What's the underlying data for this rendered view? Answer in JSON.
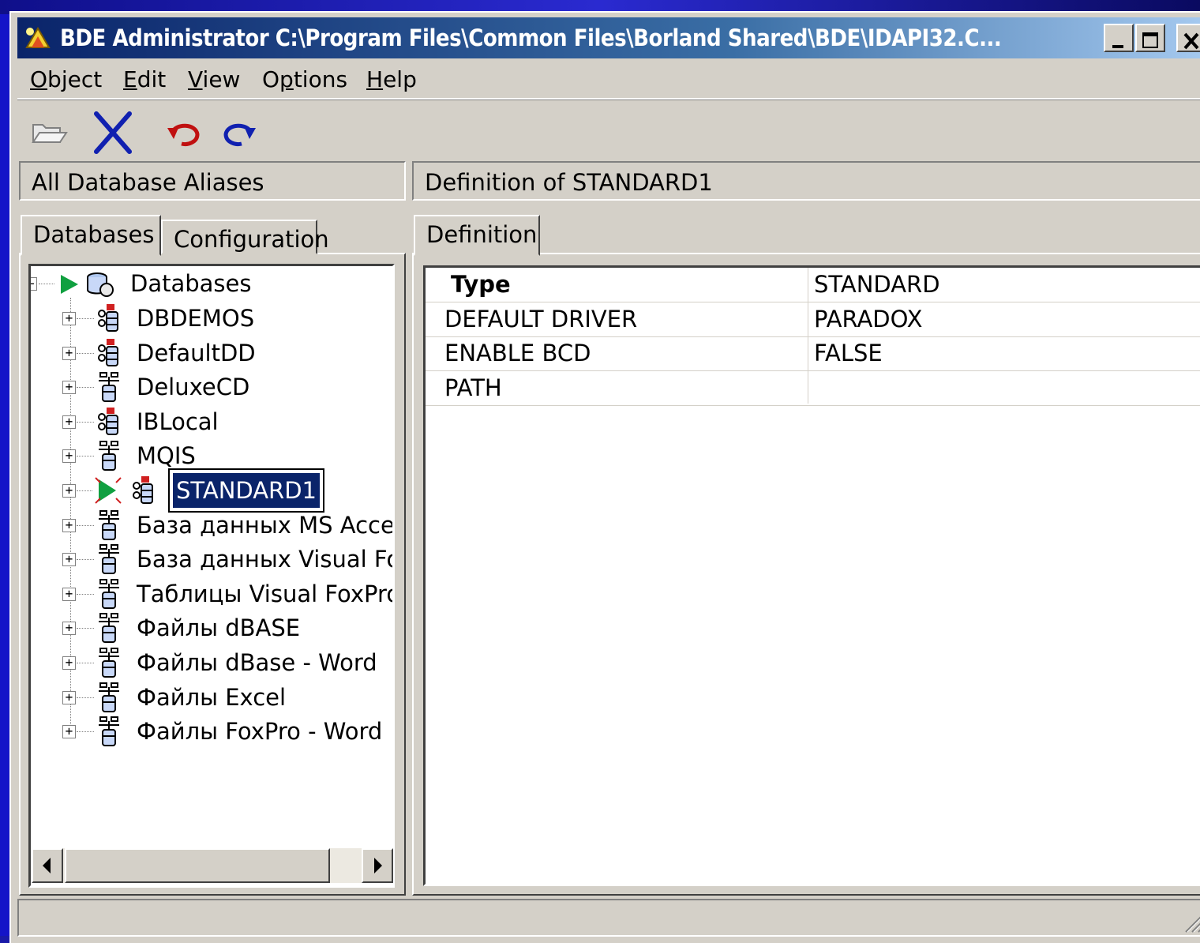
{
  "window": {
    "title": "BDE Administrator  C:\\Program Files\\Common Files\\Borland Shared\\BDE\\IDAPI32.C...",
    "controls": {
      "minimize": "minimize",
      "maximize": "maximize",
      "close": "close"
    }
  },
  "menu": [
    {
      "pre": "",
      "u": "O",
      "post": "bject"
    },
    {
      "pre": "",
      "u": "E",
      "post": "dit"
    },
    {
      "pre": "",
      "u": "V",
      "post": "iew"
    },
    {
      "pre": "O",
      "u": "p",
      "post": "tions"
    },
    {
      "pre": "",
      "u": "H",
      "post": "elp"
    }
  ],
  "toolbar": {
    "open_icon": "open-folder-icon",
    "delete_icon": "delete-x-icon",
    "undo_icon": "undo-arrow-icon",
    "redo_icon": "redo-arrow-icon"
  },
  "left_panel": {
    "header": "All Database Aliases",
    "tabs": [
      "Databases",
      "Configuration"
    ],
    "tree": {
      "root": "Databases",
      "items": [
        {
          "label": "DBDEMOS",
          "icon": "database-alias-icon"
        },
        {
          "label": "DefaultDD",
          "icon": "database-alias-icon"
        },
        {
          "label": "DeluxeCD",
          "icon": "odbc-alias-icon"
        },
        {
          "label": "IBLocal",
          "icon": "database-alias-icon"
        },
        {
          "label": "MQIS",
          "icon": "odbc-alias-icon"
        },
        {
          "label": "STANDARD1",
          "icon": "database-alias-icon",
          "selected": true
        },
        {
          "label": "База данных MS Access",
          "icon": "odbc-alias-icon"
        },
        {
          "label": "База данных Visual FoxPro",
          "icon": "odbc-alias-icon"
        },
        {
          "label": "Таблицы Visual FoxPro",
          "icon": "odbc-alias-icon"
        },
        {
          "label": "Файлы dBASE",
          "icon": "odbc-alias-icon"
        },
        {
          "label": "Файлы dBase - Word",
          "icon": "odbc-alias-icon"
        },
        {
          "label": "Файлы Excel",
          "icon": "odbc-alias-icon"
        },
        {
          "label": "Файлы FoxPro - Word",
          "icon": "odbc-alias-icon"
        }
      ]
    }
  },
  "right_panel": {
    "header": "Definition of STANDARD1",
    "tab": "Definition",
    "rows": [
      {
        "key": "Type",
        "value": "STANDARD",
        "bold": true
      },
      {
        "key": "DEFAULT DRIVER",
        "value": "PARADOX"
      },
      {
        "key": "ENABLE BCD",
        "value": "FALSE"
      },
      {
        "key": "PATH",
        "value": ""
      }
    ]
  },
  "colors": {
    "desktop": "#1a1aa8",
    "titlebar_start": "#0a246a",
    "titlebar_end": "#a6caf0",
    "selection": "#0a246a",
    "face": "#d4d0c8"
  }
}
